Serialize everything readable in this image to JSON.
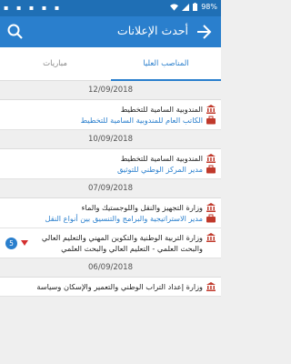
{
  "status": {
    "left_icons": "▪ ▪ ▪ ▪ ▪",
    "battery": "98%"
  },
  "header": {
    "title": "أحدث الإعلانات"
  },
  "tabs": [
    {
      "label": "المناصب العليا"
    },
    {
      "label": "مباريات"
    }
  ],
  "groups": [
    {
      "date": "12/09/2018",
      "items": [
        {
          "org": "المندوبية السامية للتخطيط",
          "pos": "الكاتب العام للمندوبية السامية للتخطيط"
        }
      ]
    },
    {
      "date": "10/09/2018",
      "items": [
        {
          "org": "المندوبية السامية للتخطيط",
          "pos": "مدير المركز الوطني للتوثيق"
        }
      ]
    },
    {
      "date": "07/09/2018",
      "items": [
        {
          "org": "وزارة التجهيز والنقل واللوجستيك والماء",
          "pos": "مدير الاستراتيجية والبرامج والتنسيق بين أنواع النقل"
        },
        {
          "org": "وزارة التربية الوطنية والتكوين المهني والتعليم العالي والبحث العلمي - التعليم العالي والبحث العلمي",
          "pos": "",
          "count": "5"
        }
      ]
    },
    {
      "date": "06/09/2018",
      "items": [
        {
          "org": "وزارة إعداد التراب الوطني والتعمير والإسكان وسياسة",
          "pos": ""
        }
      ]
    }
  ]
}
